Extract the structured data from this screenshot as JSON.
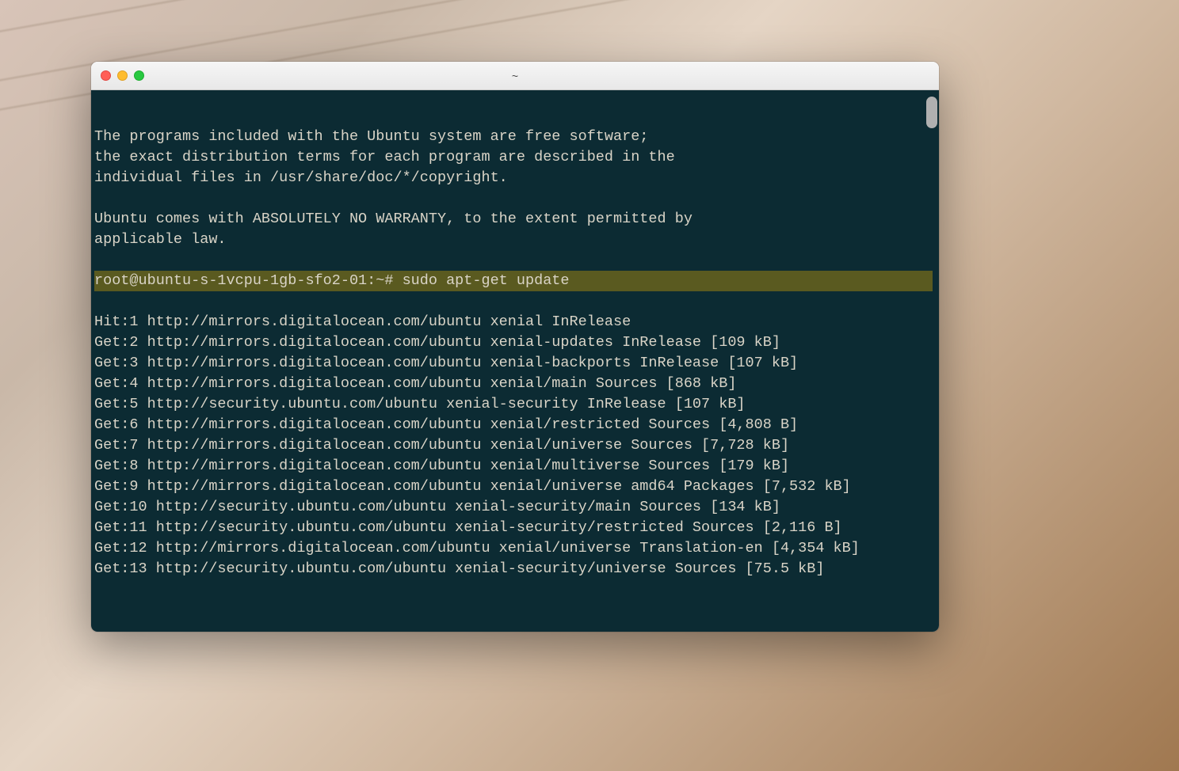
{
  "window": {
    "title": "~"
  },
  "terminal": {
    "intro_lines": [
      "",
      "The programs included with the Ubuntu system are free software;",
      "the exact distribution terms for each program are described in the",
      "individual files in /usr/share/doc/*/copyright.",
      "",
      "Ubuntu comes with ABSOLUTELY NO WARRANTY, to the extent permitted by",
      "applicable law.",
      ""
    ],
    "prompt": "root@ubuntu-s-1vcpu-1gb-sfo2-01:~# sudo apt-get update",
    "output_lines": [
      "Hit:1 http://mirrors.digitalocean.com/ubuntu xenial InRelease",
      "Get:2 http://mirrors.digitalocean.com/ubuntu xenial-updates InRelease [109 kB]",
      "Get:3 http://mirrors.digitalocean.com/ubuntu xenial-backports InRelease [107 kB]",
      "Get:4 http://mirrors.digitalocean.com/ubuntu xenial/main Sources [868 kB]",
      "Get:5 http://security.ubuntu.com/ubuntu xenial-security InRelease [107 kB]",
      "Get:6 http://mirrors.digitalocean.com/ubuntu xenial/restricted Sources [4,808 B]",
      "Get:7 http://mirrors.digitalocean.com/ubuntu xenial/universe Sources [7,728 kB]",
      "Get:8 http://mirrors.digitalocean.com/ubuntu xenial/multiverse Sources [179 kB]",
      "Get:9 http://mirrors.digitalocean.com/ubuntu xenial/universe amd64 Packages [7,532 kB]",
      "Get:10 http://security.ubuntu.com/ubuntu xenial-security/main Sources [134 kB]",
      "Get:11 http://security.ubuntu.com/ubuntu xenial-security/restricted Sources [2,116 B]",
      "Get:12 http://mirrors.digitalocean.com/ubuntu xenial/universe Translation-en [4,354 kB]",
      "Get:13 http://security.ubuntu.com/ubuntu xenial-security/universe Sources [75.5 kB]"
    ]
  }
}
